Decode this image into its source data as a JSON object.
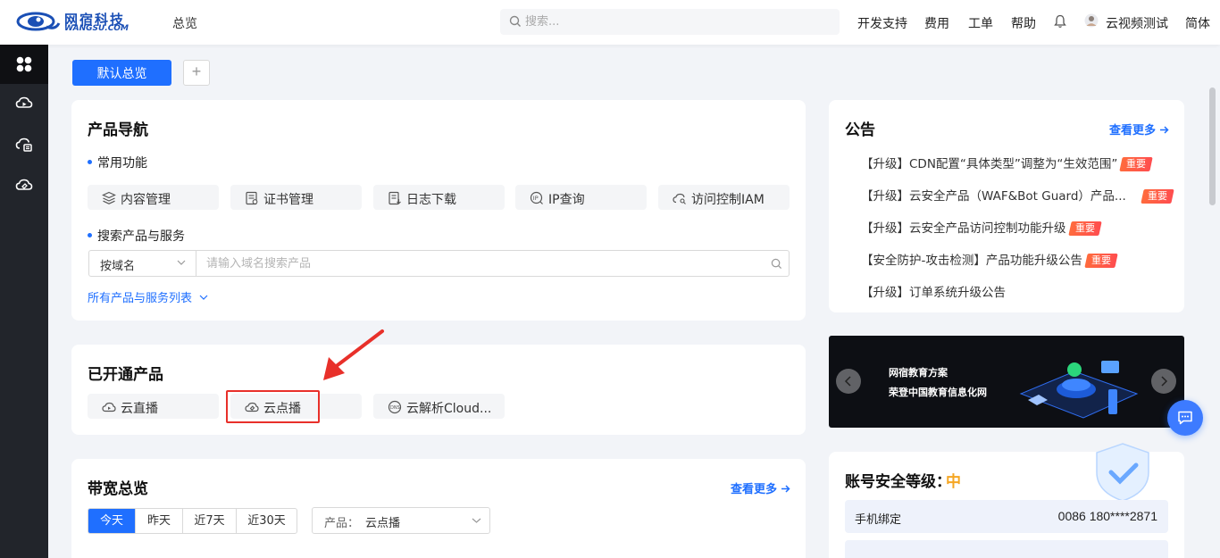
{
  "header": {
    "logo_cn": "网宿科技",
    "logo_en": "WANGSU.COM",
    "overview": "总览",
    "search_placeholder": "搜索...",
    "nav": [
      "开发支持",
      "费用",
      "工单",
      "帮助"
    ],
    "user": "云视频测试",
    "lang": "简体"
  },
  "sidebar": {
    "icons": [
      "grid-icon",
      "cloud-live-icon",
      "cloud-lock-icon",
      "cloud-vod-icon"
    ]
  },
  "toolbar": {
    "default_view": "默认总览",
    "add": "+"
  },
  "product_nav": {
    "title": "产品导航",
    "common_label": "常用功能",
    "common": [
      "内容管理",
      "证书管理",
      "日志下载",
      "IP查询",
      "访问控制IAM"
    ],
    "search_label": "搜索产品与服务",
    "search_select": "按域名",
    "search_placeholder": "请输入域名搜索产品",
    "all_products": "所有产品与服务列表"
  },
  "opened": {
    "title": "已开通产品",
    "items": [
      "云直播",
      "云点播",
      "云解析Cloud..."
    ]
  },
  "bandwidth": {
    "title": "带宽总览",
    "more": "查看更多",
    "tabs": [
      "今天",
      "昨天",
      "近7天",
      "近30天"
    ],
    "product_label": "产品：",
    "product_value": "云点播"
  },
  "notice": {
    "title": "公告",
    "more": "查看更多",
    "items": [
      {
        "text": "【升级】CDN配置“具体类型”调整为“生效范围”",
        "tag": "重要"
      },
      {
        "text": "【升级】云安全产品（WAF&Bot Guard）产品...",
        "tag": "重要"
      },
      {
        "text": "【升级】云安全产品访问控制功能升级",
        "tag": "重要"
      },
      {
        "text": "【安全防护-攻击检测】产品功能升级公告",
        "tag": "重要"
      },
      {
        "text": "【升级】订单系统升级公告",
        "tag": ""
      }
    ]
  },
  "banner": {
    "line1": "网宿教育方案",
    "line2": "荣登中国教育信息化网"
  },
  "security": {
    "title": "账号安全等级：",
    "level": "中",
    "level_color": "#f5a623",
    "phone_label": "手机绑定",
    "phone_value": "0086 180****2871"
  },
  "colors": {
    "accent": "#1f6fff",
    "highlight": "#e8302a"
  }
}
